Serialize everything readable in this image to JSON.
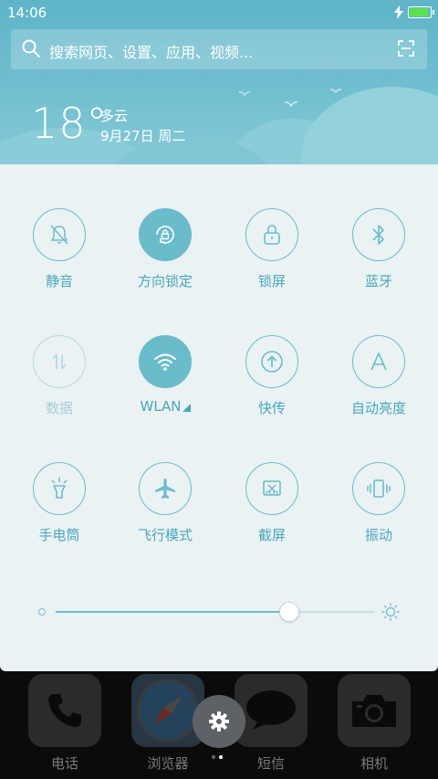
{
  "status_bar": {
    "time": "14:06",
    "battery_level": 1.0,
    "charging": true,
    "battery_color": "#5de04b"
  },
  "search": {
    "placeholder": "搜索网页、设置、应用、视频..."
  },
  "weather": {
    "temperature": "18°",
    "condition": "多云",
    "date": "9月27日 周二"
  },
  "quick_settings": {
    "tiles": [
      {
        "id": "silent",
        "label": "静音",
        "icon": "bell-off-icon",
        "state": "off"
      },
      {
        "id": "rotation-lock",
        "label": "方向锁定",
        "icon": "rotation-lock-icon",
        "state": "on"
      },
      {
        "id": "lock-screen",
        "label": "锁屏",
        "icon": "lock-icon",
        "state": "off"
      },
      {
        "id": "bluetooth",
        "label": "蓝牙",
        "icon": "bluetooth-icon",
        "state": "off"
      },
      {
        "id": "data",
        "label": "数据",
        "icon": "data-arrows-icon",
        "state": "disabled"
      },
      {
        "id": "wlan",
        "label": "WLAN",
        "icon": "wifi-icon",
        "state": "on"
      },
      {
        "id": "quick-transfer",
        "label": "快传",
        "icon": "upload-icon",
        "state": "off"
      },
      {
        "id": "auto-brightness",
        "label": "自动亮度",
        "icon": "auto-brightness-icon",
        "state": "off"
      },
      {
        "id": "flashlight",
        "label": "手电筒",
        "icon": "flashlight-icon",
        "state": "off"
      },
      {
        "id": "airplane",
        "label": "飞行模式",
        "icon": "airplane-icon",
        "state": "off"
      },
      {
        "id": "screenshot",
        "label": "截屏",
        "icon": "screenshot-icon",
        "state": "off"
      },
      {
        "id": "vibrate",
        "label": "振动",
        "icon": "vibrate-icon",
        "state": "off"
      }
    ],
    "brightness_level": 0.73
  },
  "dock": {
    "apps": [
      {
        "label": "电话",
        "icon": "phone-icon"
      },
      {
        "label": "浏览器",
        "icon": "compass-icon"
      },
      {
        "label": "短信",
        "icon": "message-icon"
      },
      {
        "label": "相机",
        "icon": "camera-icon"
      }
    ],
    "page_count": 2,
    "current_page": 2
  },
  "colors": {
    "accent": "#6bbccb",
    "panel_bg": "#eaf2f4",
    "header_bg": "#6ab9cc"
  }
}
